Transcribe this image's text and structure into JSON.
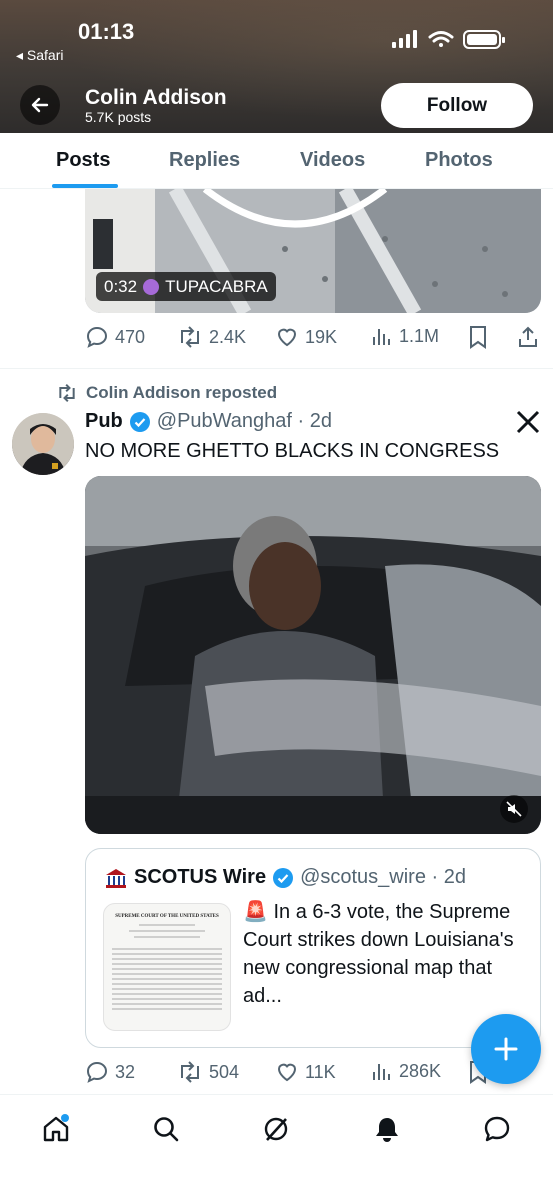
{
  "status_bar": {
    "time": "01:13",
    "back_app": "◂ Safari"
  },
  "profile": {
    "name": "Colin Addison",
    "posts": "5.7K posts",
    "follow_label": "Follow"
  },
  "tabs": [
    {
      "label": "Posts",
      "active": true
    },
    {
      "label": "Replies",
      "active": false
    },
    {
      "label": "Videos",
      "active": false
    },
    {
      "label": "Photos",
      "active": false
    }
  ],
  "tweet1": {
    "video_time": "0:32",
    "video_badge": "TUPACABRA",
    "replies": "470",
    "reposts": "2.4K",
    "likes": "19K",
    "views": "1.1M"
  },
  "tweet2": {
    "repost_label": "Colin Addison reposted",
    "author_name": "Pub",
    "handle_date": "@PubWanghaf · 2d",
    "text": "NO MORE GHETTO BLACKS IN CONGRESS",
    "quote": {
      "author_name": "SCOTUS Wire",
      "handle_date": "@scotus_wire · 2d",
      "text": "🚨 In a 6-3 vote, the Supreme Court strikes down Louisiana's new congressional map that ad...",
      "doc_heading": "SUPREME COURT OF THE UNITED STATES"
    },
    "replies": "32",
    "reposts": "504",
    "likes": "11K",
    "views": "286K"
  },
  "colors": {
    "accent": "#1d9bf0",
    "muted": "#536471",
    "text": "#0f1419"
  },
  "bottom_nav": [
    "home-icon",
    "search-icon",
    "grok-icon",
    "notifications-icon",
    "messages-icon"
  ]
}
